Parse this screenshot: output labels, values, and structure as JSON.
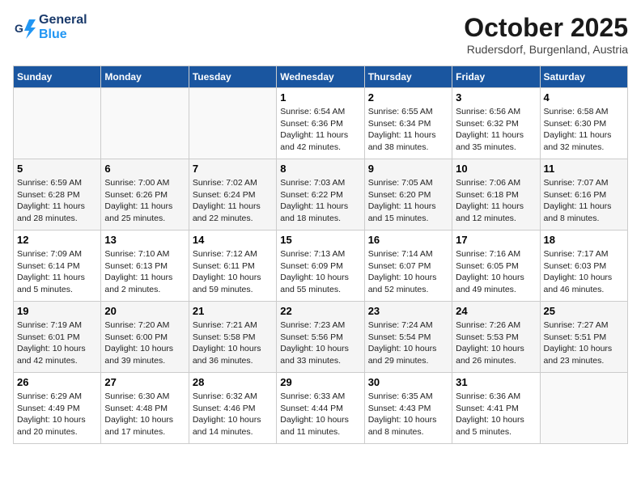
{
  "header": {
    "logo_line1": "General",
    "logo_line2": "Blue",
    "month": "October 2025",
    "location": "Rudersdorf, Burgenland, Austria"
  },
  "days_of_week": [
    "Sunday",
    "Monday",
    "Tuesday",
    "Wednesday",
    "Thursday",
    "Friday",
    "Saturday"
  ],
  "weeks": [
    [
      {
        "day": "",
        "info": ""
      },
      {
        "day": "",
        "info": ""
      },
      {
        "day": "",
        "info": ""
      },
      {
        "day": "1",
        "info": "Sunrise: 6:54 AM\nSunset: 6:36 PM\nDaylight: 11 hours and 42 minutes."
      },
      {
        "day": "2",
        "info": "Sunrise: 6:55 AM\nSunset: 6:34 PM\nDaylight: 11 hours and 38 minutes."
      },
      {
        "day": "3",
        "info": "Sunrise: 6:56 AM\nSunset: 6:32 PM\nDaylight: 11 hours and 35 minutes."
      },
      {
        "day": "4",
        "info": "Sunrise: 6:58 AM\nSunset: 6:30 PM\nDaylight: 11 hours and 32 minutes."
      }
    ],
    [
      {
        "day": "5",
        "info": "Sunrise: 6:59 AM\nSunset: 6:28 PM\nDaylight: 11 hours and 28 minutes."
      },
      {
        "day": "6",
        "info": "Sunrise: 7:00 AM\nSunset: 6:26 PM\nDaylight: 11 hours and 25 minutes."
      },
      {
        "day": "7",
        "info": "Sunrise: 7:02 AM\nSunset: 6:24 PM\nDaylight: 11 hours and 22 minutes."
      },
      {
        "day": "8",
        "info": "Sunrise: 7:03 AM\nSunset: 6:22 PM\nDaylight: 11 hours and 18 minutes."
      },
      {
        "day": "9",
        "info": "Sunrise: 7:05 AM\nSunset: 6:20 PM\nDaylight: 11 hours and 15 minutes."
      },
      {
        "day": "10",
        "info": "Sunrise: 7:06 AM\nSunset: 6:18 PM\nDaylight: 11 hours and 12 minutes."
      },
      {
        "day": "11",
        "info": "Sunrise: 7:07 AM\nSunset: 6:16 PM\nDaylight: 11 hours and 8 minutes."
      }
    ],
    [
      {
        "day": "12",
        "info": "Sunrise: 7:09 AM\nSunset: 6:14 PM\nDaylight: 11 hours and 5 minutes."
      },
      {
        "day": "13",
        "info": "Sunrise: 7:10 AM\nSunset: 6:13 PM\nDaylight: 11 hours and 2 minutes."
      },
      {
        "day": "14",
        "info": "Sunrise: 7:12 AM\nSunset: 6:11 PM\nDaylight: 10 hours and 59 minutes."
      },
      {
        "day": "15",
        "info": "Sunrise: 7:13 AM\nSunset: 6:09 PM\nDaylight: 10 hours and 55 minutes."
      },
      {
        "day": "16",
        "info": "Sunrise: 7:14 AM\nSunset: 6:07 PM\nDaylight: 10 hours and 52 minutes."
      },
      {
        "day": "17",
        "info": "Sunrise: 7:16 AM\nSunset: 6:05 PM\nDaylight: 10 hours and 49 minutes."
      },
      {
        "day": "18",
        "info": "Sunrise: 7:17 AM\nSunset: 6:03 PM\nDaylight: 10 hours and 46 minutes."
      }
    ],
    [
      {
        "day": "19",
        "info": "Sunrise: 7:19 AM\nSunset: 6:01 PM\nDaylight: 10 hours and 42 minutes."
      },
      {
        "day": "20",
        "info": "Sunrise: 7:20 AM\nSunset: 6:00 PM\nDaylight: 10 hours and 39 minutes."
      },
      {
        "day": "21",
        "info": "Sunrise: 7:21 AM\nSunset: 5:58 PM\nDaylight: 10 hours and 36 minutes."
      },
      {
        "day": "22",
        "info": "Sunrise: 7:23 AM\nSunset: 5:56 PM\nDaylight: 10 hours and 33 minutes."
      },
      {
        "day": "23",
        "info": "Sunrise: 7:24 AM\nSunset: 5:54 PM\nDaylight: 10 hours and 29 minutes."
      },
      {
        "day": "24",
        "info": "Sunrise: 7:26 AM\nSunset: 5:53 PM\nDaylight: 10 hours and 26 minutes."
      },
      {
        "day": "25",
        "info": "Sunrise: 7:27 AM\nSunset: 5:51 PM\nDaylight: 10 hours and 23 minutes."
      }
    ],
    [
      {
        "day": "26",
        "info": "Sunrise: 6:29 AM\nSunset: 4:49 PM\nDaylight: 10 hours and 20 minutes."
      },
      {
        "day": "27",
        "info": "Sunrise: 6:30 AM\nSunset: 4:48 PM\nDaylight: 10 hours and 17 minutes."
      },
      {
        "day": "28",
        "info": "Sunrise: 6:32 AM\nSunset: 4:46 PM\nDaylight: 10 hours and 14 minutes."
      },
      {
        "day": "29",
        "info": "Sunrise: 6:33 AM\nSunset: 4:44 PM\nDaylight: 10 hours and 11 minutes."
      },
      {
        "day": "30",
        "info": "Sunrise: 6:35 AM\nSunset: 4:43 PM\nDaylight: 10 hours and 8 minutes."
      },
      {
        "day": "31",
        "info": "Sunrise: 6:36 AM\nSunset: 4:41 PM\nDaylight: 10 hours and 5 minutes."
      },
      {
        "day": "",
        "info": ""
      }
    ]
  ]
}
